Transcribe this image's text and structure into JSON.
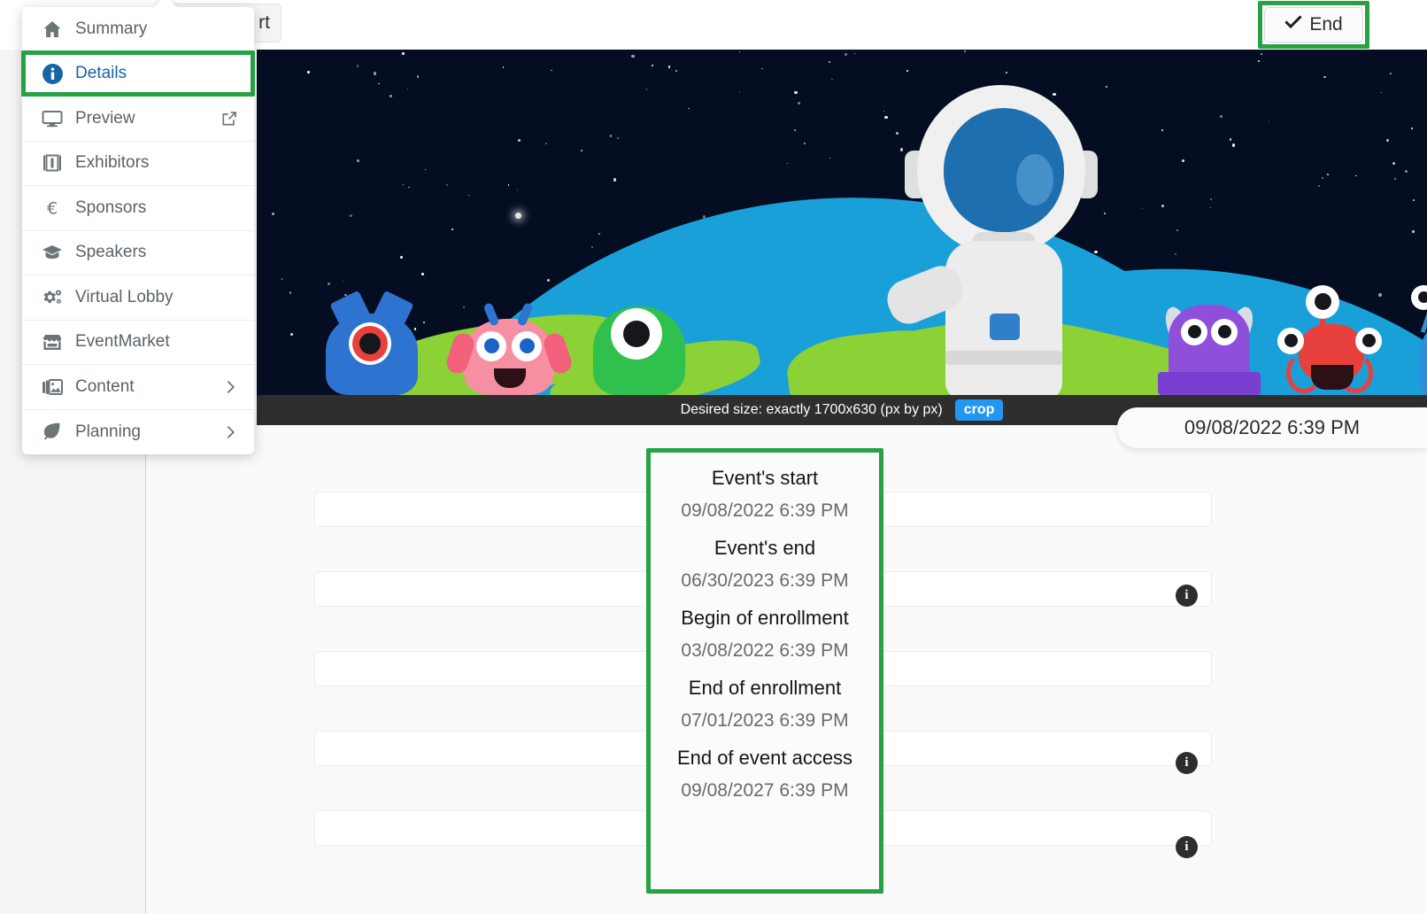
{
  "topbar": {
    "partial_button_label": "rt",
    "end_button": {
      "label": "End",
      "icon": "check-icon"
    }
  },
  "menu": {
    "items": [
      {
        "label": "Summary",
        "icon": "home-icon",
        "active": false,
        "right_icon": ""
      },
      {
        "label": "Details",
        "icon": "info-circle-icon",
        "active": true,
        "right_icon": ""
      },
      {
        "label": "Preview",
        "icon": "monitor-icon",
        "active": false,
        "right_icon": "external-link-icon"
      },
      {
        "label": "Exhibitors",
        "icon": "book-icon",
        "active": false,
        "right_icon": ""
      },
      {
        "label": "Sponsors",
        "icon": "euro-icon",
        "active": false,
        "right_icon": ""
      },
      {
        "label": "Speakers",
        "icon": "graduation-cap-icon",
        "active": false,
        "right_icon": ""
      },
      {
        "label": "Virtual Lobby",
        "icon": "cogs-icon",
        "active": false,
        "right_icon": ""
      },
      {
        "label": "EventMarket",
        "icon": "store-icon",
        "active": false,
        "right_icon": ""
      },
      {
        "label": "Content",
        "icon": "images-icon",
        "active": false,
        "right_icon": "chevron-right-icon"
      },
      {
        "label": "Planning",
        "icon": "leaf-icon",
        "active": false,
        "right_icon": "chevron-right-icon"
      }
    ]
  },
  "banner": {
    "size_hint": "Desired size: exactly 1700x630 (px by px)",
    "crop_label": "crop"
  },
  "date_pill": {
    "value": "09/08/2022 6:39 PM"
  },
  "dates": [
    {
      "label": "Event's start",
      "value": "09/08/2022 6:39 PM"
    },
    {
      "label": "Event's end",
      "value": "06/30/2023 6:39 PM"
    },
    {
      "label": "Begin of enrollment",
      "value": "03/08/2022 6:39 PM"
    },
    {
      "label": "End of enrollment",
      "value": "07/01/2023 6:39 PM"
    },
    {
      "label": "End of event access",
      "value": "09/08/2027 6:39 PM"
    }
  ],
  "colors": {
    "highlight_green": "#26a244",
    "active_blue": "#1565a8",
    "crop_blue": "#2196f3",
    "bar_dark": "#2e2e2e"
  }
}
